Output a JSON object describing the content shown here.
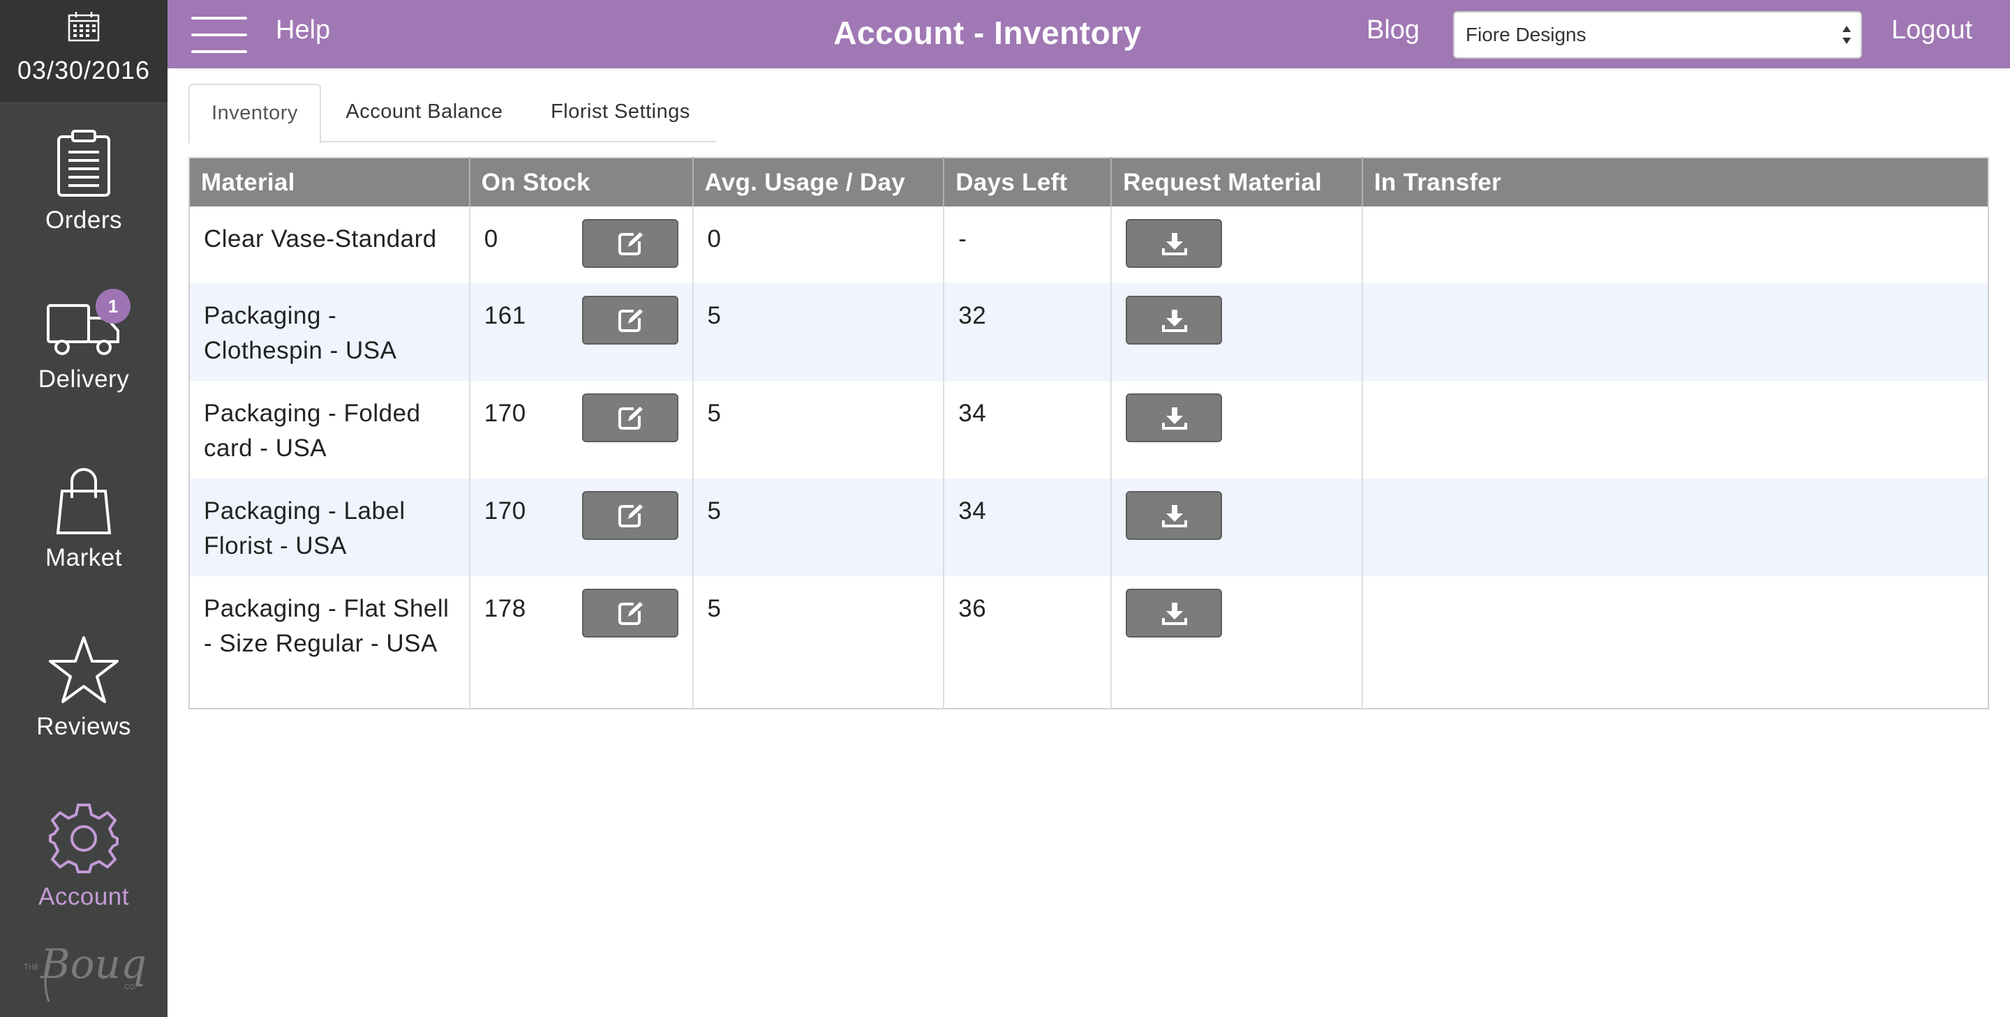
{
  "sidebar": {
    "date": "03/30/2016",
    "items": [
      {
        "label": "Orders",
        "icon": "clipboard-icon",
        "active": false
      },
      {
        "label": "Delivery",
        "icon": "truck-icon",
        "badge": "1",
        "active": false
      },
      {
        "label": "Market",
        "icon": "shopping-bag-icon",
        "active": false
      },
      {
        "label": "Reviews",
        "icon": "star-icon",
        "active": false
      },
      {
        "label": "Account",
        "icon": "gear-icon",
        "active": true
      }
    ],
    "logo": {
      "text": "The Bouqs Co."
    }
  },
  "header": {
    "help_label": "Help",
    "title": "Account - Inventory",
    "blog_label": "Blog",
    "store_select": {
      "value": "Fiore Designs"
    },
    "logout_label": "Logout",
    "accent_color": "#a078b4"
  },
  "tabs": [
    {
      "label": "Inventory",
      "active": true
    },
    {
      "label": "Account Balance",
      "active": false
    },
    {
      "label": "Florist Settings",
      "active": false
    }
  ],
  "table": {
    "headers": [
      "Material",
      "On Stock",
      "Avg. Usage / Day",
      "Days Left",
      "Request Material",
      "In Transfer"
    ],
    "rows": [
      {
        "material": "Clear Vase-Standard",
        "on_stock": "0",
        "avg_usage": "0",
        "days_left": "-",
        "in_transfer": ""
      },
      {
        "material": "Packaging - Clothespin - USA",
        "on_stock": "161",
        "avg_usage": "5",
        "days_left": "32",
        "in_transfer": ""
      },
      {
        "material": "Packaging - Folded card - USA",
        "on_stock": "170",
        "avg_usage": "5",
        "days_left": "34",
        "in_transfer": ""
      },
      {
        "material": "Packaging - Label Florist - USA",
        "on_stock": "170",
        "avg_usage": "5",
        "days_left": "34",
        "in_transfer": ""
      },
      {
        "material": "Packaging - Flat Shell - Size Regular - USA",
        "on_stock": "178",
        "avg_usage": "5",
        "days_left": "36",
        "in_transfer": ""
      }
    ],
    "edit_icon": "edit-icon",
    "request_icon": "download-icon"
  }
}
